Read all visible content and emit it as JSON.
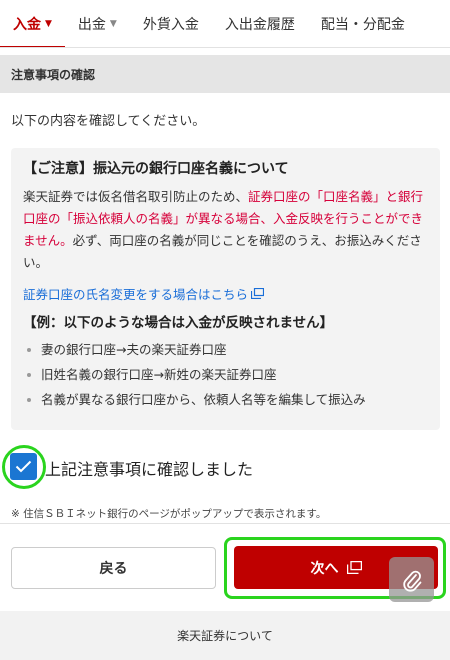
{
  "tabs": [
    {
      "label": "入金",
      "has_caret": true,
      "active": true
    },
    {
      "label": "出金",
      "has_caret": true,
      "active": false
    },
    {
      "label": "外貨入金",
      "has_caret": false,
      "active": false
    },
    {
      "label": "入出金履歴",
      "has_caret": false,
      "active": false
    },
    {
      "label": "配当・分配金",
      "has_caret": false,
      "active": false
    }
  ],
  "section_title": "注意事項の確認",
  "intro_text": "以下の内容を確認してください。",
  "notice": {
    "title": "【ご注意】振込元の銀行口座名義について",
    "body_part1": "楽天証券では仮名借名取引防止のため、",
    "body_red": "証券口座の「口座名義」と銀行口座の「振込依頼人の名義」が異なる場合、入金反映を行うことができません。",
    "body_part2": "必ず、両口座の名義が同じことを確認のうえ、お振込みください。",
    "link_text": "証券口座の氏名変更をする場合はこちら",
    "example_title": "【例：以下のような場合は入金が反映されません】",
    "examples": [
      "妻の銀行口座→夫の楽天証券口座",
      "旧姓名義の銀行口座→新姓の楽天証券口座",
      "名義が異なる銀行口座から、依頼人名等を編集して振込み"
    ]
  },
  "confirm_checkbox": {
    "label": "上記注意事項に確認しました",
    "checked": true
  },
  "note": "※ 住信ＳＢＩネット銀行のページがポップアップで表示されます。",
  "buttons": {
    "back": "戻る",
    "next": "次へ"
  },
  "footer_text": "楽天証券について",
  "colors": {
    "brand_red": "#bf0000",
    "link_blue": "#1a6ed8",
    "checkbox_blue": "#1b76d2",
    "highlight_green": "#2ad41e",
    "warning_red": "#d6003a"
  },
  "icons": {
    "external": "external-window-icon",
    "check": "check-icon",
    "caret": "caret-down-icon",
    "clip": "paperclip-icon"
  }
}
